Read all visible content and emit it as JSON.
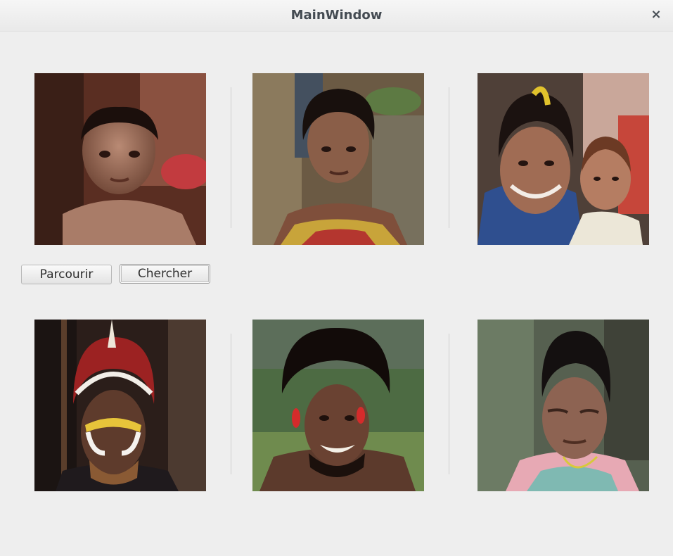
{
  "window": {
    "title": "MainWindow",
    "close_symbol": "×"
  },
  "buttons": {
    "browse_label": "Parcourir",
    "search_label": "Chercher"
  },
  "images": [
    {
      "icon": "photo-boy"
    },
    {
      "icon": "photo-woman"
    },
    {
      "icon": "photo-woman-with-child"
    },
    {
      "icon": "photo-man-painted-face"
    },
    {
      "icon": "photo-man-smiling"
    },
    {
      "icon": "photo-woman-looking-down"
    }
  ]
}
